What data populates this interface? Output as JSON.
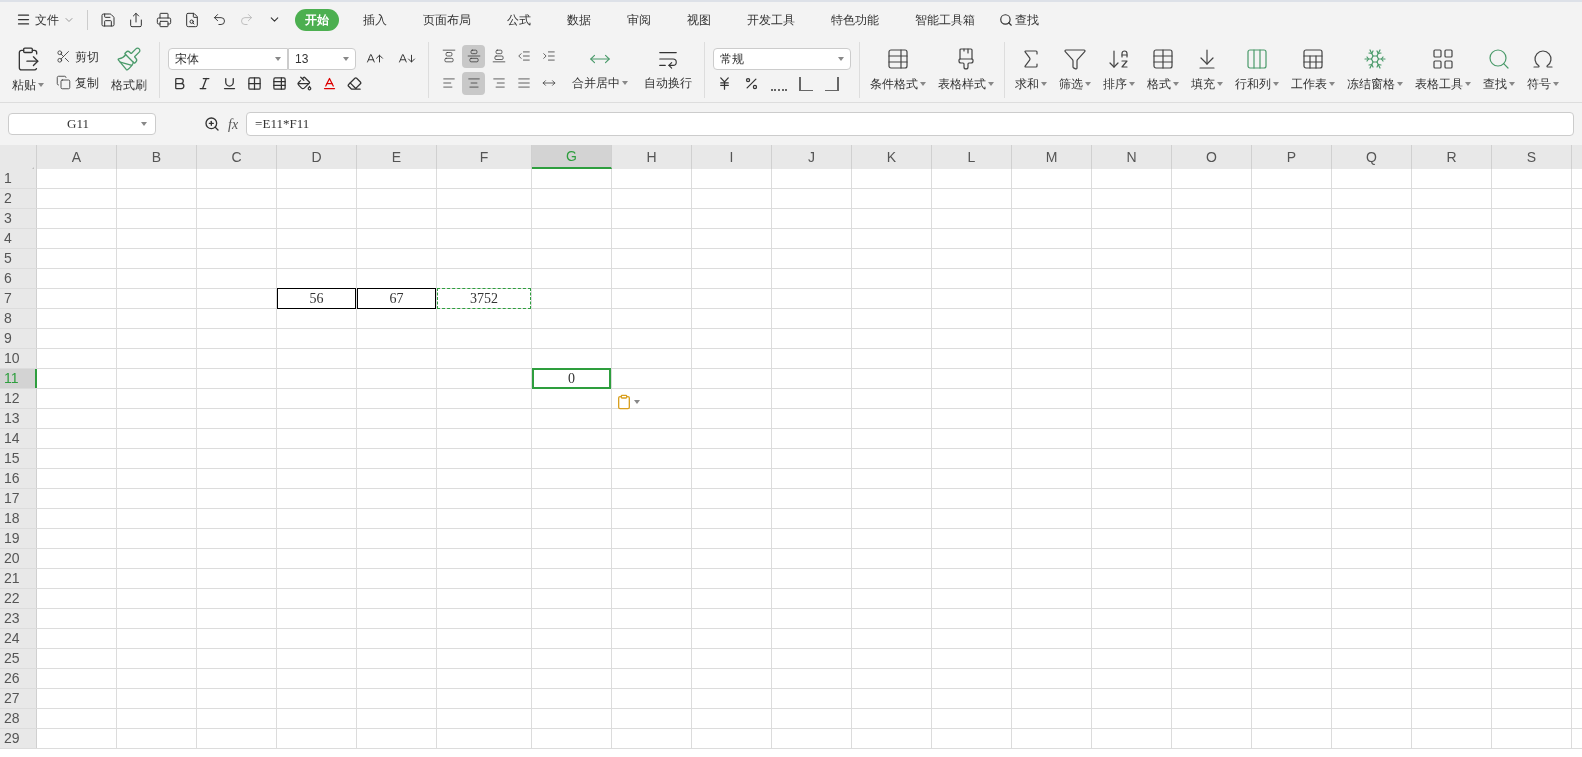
{
  "menu": {
    "file_label": "文件",
    "tabs": [
      {
        "label": "开始",
        "selected": true
      },
      {
        "label": "插入",
        "selected": false
      },
      {
        "label": "页面布局",
        "selected": false
      },
      {
        "label": "公式",
        "selected": false
      },
      {
        "label": "数据",
        "selected": false
      },
      {
        "label": "审阅",
        "selected": false
      },
      {
        "label": "视图",
        "selected": false
      },
      {
        "label": "开发工具",
        "selected": false
      },
      {
        "label": "特色功能",
        "selected": false
      },
      {
        "label": "智能工具箱",
        "selected": false
      }
    ],
    "search_label": "查找"
  },
  "clipboard": {
    "paste": "粘贴",
    "cut": "剪切",
    "copy": "复制",
    "format_painter": "格式刷"
  },
  "font": {
    "name": "宋体",
    "size": "13"
  },
  "alignment": {
    "top_row": [
      {
        "kind": "top",
        "selected": false
      },
      {
        "kind": "middle",
        "selected": true
      },
      {
        "kind": "bottom",
        "selected": false
      },
      {
        "kind": "outdent",
        "selected": false
      },
      {
        "kind": "indent",
        "selected": false
      }
    ],
    "bottom_row": [
      {
        "kind": "left",
        "selected": false
      },
      {
        "kind": "center",
        "selected": true
      },
      {
        "kind": "right",
        "selected": false
      },
      {
        "kind": "justify",
        "selected": false
      },
      {
        "kind": "distribute",
        "selected": false
      }
    ],
    "merge": "合并居中",
    "wrap": "自动换行"
  },
  "number": {
    "format": "常规"
  },
  "styles": [
    {
      "kind": "conditional",
      "label": "条件格式"
    },
    {
      "kind": "table-style",
      "label": "表格样式"
    }
  ],
  "tools": [
    {
      "kind": "sum",
      "label": "求和"
    },
    {
      "kind": "filter",
      "label": "筛选"
    },
    {
      "kind": "sort",
      "label": "排序"
    },
    {
      "kind": "format",
      "label": "格式"
    },
    {
      "kind": "fill",
      "label": "填充"
    },
    {
      "kind": "rowcol",
      "label": "行和列"
    },
    {
      "kind": "sheet",
      "label": "工作表"
    },
    {
      "kind": "freeze",
      "label": "冻结窗格"
    },
    {
      "kind": "tabletools",
      "label": "表格工具"
    },
    {
      "kind": "find",
      "label": "查找"
    },
    {
      "kind": "symbol",
      "label": "符号"
    }
  ],
  "formula_bar": {
    "name_box": "G11",
    "fx_label": "fx",
    "formula": "=E11*F11"
  },
  "grid": {
    "columns": [
      {
        "label": "A",
        "selected": false
      },
      {
        "label": "B",
        "selected": false
      },
      {
        "label": "C",
        "selected": false
      },
      {
        "label": "D",
        "selected": false
      },
      {
        "label": "E",
        "selected": false
      },
      {
        "label": "F",
        "selected": false
      },
      {
        "label": "G",
        "selected": true
      },
      {
        "label": "H",
        "selected": false
      },
      {
        "label": "I",
        "selected": false
      },
      {
        "label": "J",
        "selected": false
      },
      {
        "label": "K",
        "selected": false
      },
      {
        "label": "L",
        "selected": false
      },
      {
        "label": "M",
        "selected": false
      },
      {
        "label": "N",
        "selected": false
      },
      {
        "label": "O",
        "selected": false
      },
      {
        "label": "P",
        "selected": false
      },
      {
        "label": "Q",
        "selected": false
      },
      {
        "label": "R",
        "selected": false
      },
      {
        "label": "S",
        "selected": false
      }
    ],
    "rows": [
      {
        "label": "1",
        "selected": false
      },
      {
        "label": "2",
        "selected": false
      },
      {
        "label": "3",
        "selected": false
      },
      {
        "label": "4",
        "selected": false
      },
      {
        "label": "5",
        "selected": false
      },
      {
        "label": "6",
        "selected": false
      },
      {
        "label": "7",
        "selected": false,
        "cells": [
          {
            "kind": "empty"
          },
          {
            "kind": "empty"
          },
          {
            "kind": "empty"
          },
          {
            "value": "56",
            "kind": "bordered"
          },
          {
            "value": "67",
            "kind": "bordered"
          },
          {
            "value": "3752",
            "kind": "copied"
          }
        ]
      },
      {
        "label": "8",
        "selected": false
      },
      {
        "label": "9",
        "selected": false
      },
      {
        "label": "10",
        "selected": false
      },
      {
        "label": "11",
        "selected": true,
        "cells": [
          {
            "kind": "empty"
          },
          {
            "kind": "empty"
          },
          {
            "kind": "empty"
          },
          {
            "kind": "empty"
          },
          {
            "kind": "empty"
          },
          {
            "kind": "empty"
          },
          {
            "value": "0",
            "kind": "active"
          }
        ]
      },
      {
        "label": "12",
        "selected": false
      },
      {
        "label": "13",
        "selected": false
      },
      {
        "label": "14",
        "selected": false
      },
      {
        "label": "15",
        "selected": false
      },
      {
        "label": "16",
        "selected": false
      },
      {
        "label": "17",
        "selected": false
      },
      {
        "label": "18",
        "selected": false
      },
      {
        "label": "19",
        "selected": false
      },
      {
        "label": "20",
        "selected": false
      },
      {
        "label": "21",
        "selected": false
      },
      {
        "label": "22",
        "selected": false
      },
      {
        "label": "23",
        "selected": false
      },
      {
        "label": "24",
        "selected": false
      },
      {
        "label": "25",
        "selected": false
      },
      {
        "label": "26",
        "selected": false
      },
      {
        "label": "27",
        "selected": false
      },
      {
        "label": "28",
        "selected": false
      },
      {
        "label": "29",
        "selected": false
      }
    ]
  }
}
